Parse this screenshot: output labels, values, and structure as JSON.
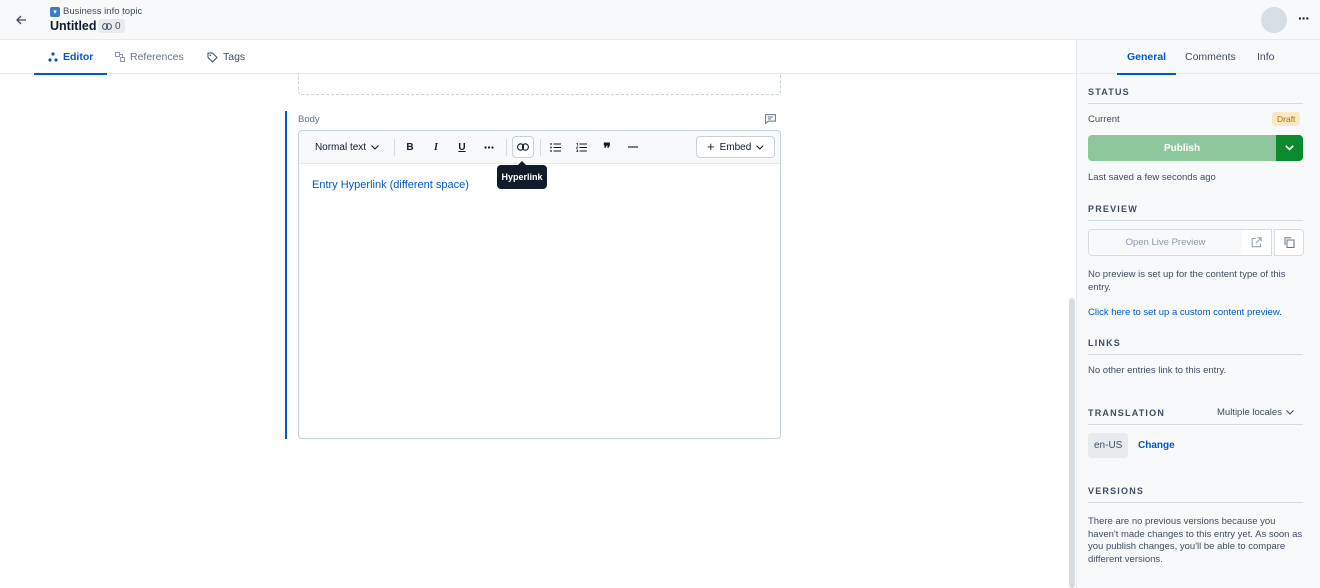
{
  "header": {
    "content_type_icon": "content-type-icon",
    "content_type": "Business info topic",
    "entry_title": "Untitled",
    "ref_count": "0"
  },
  "editor_tabs": [
    {
      "label": "Editor",
      "icon": "editor-icon"
    },
    {
      "label": "References",
      "icon": "references-icon"
    },
    {
      "label": "Tags",
      "icon": "tag-icon"
    }
  ],
  "field": {
    "label": "Body"
  },
  "toolbar": {
    "format_select": "Normal text",
    "bold": "B",
    "italic": "I",
    "underline": "U",
    "embed_label": "Embed"
  },
  "content": {
    "hyperlink_text": "Entry Hyperlink (different space)"
  },
  "tooltip": {
    "text": "Hyperlink"
  },
  "sidebar": {
    "tabs": [
      "General",
      "Comments",
      "Info"
    ],
    "status": {
      "heading": "STATUS",
      "current_label": "Current",
      "badge": "Draft",
      "publish_label": "Publish",
      "last_saved": "Last saved a few seconds ago"
    },
    "preview": {
      "heading": "PREVIEW",
      "open_label": "Open Live Preview",
      "no_preview_text": "No preview is set up for the content type of this entry.",
      "setup_link": "Click here to set up a custom content preview."
    },
    "links": {
      "heading": "LINKS",
      "text": "No other entries link to this entry."
    },
    "translation": {
      "heading": "TRANSLATION",
      "mode": "Multiple locales",
      "locale": "en-US",
      "change_label": "Change"
    },
    "versions": {
      "heading": "VERSIONS",
      "text": "There are no previous versions because you haven't made changes to this entry yet. As soon as you publish changes, you'll be able to compare different versions."
    }
  },
  "colors": {
    "accent": "#0059c8",
    "publish_disabled": "#8fc79c",
    "publish_caret": "#0e8a2e",
    "draft_bg": "#fde8c4"
  }
}
